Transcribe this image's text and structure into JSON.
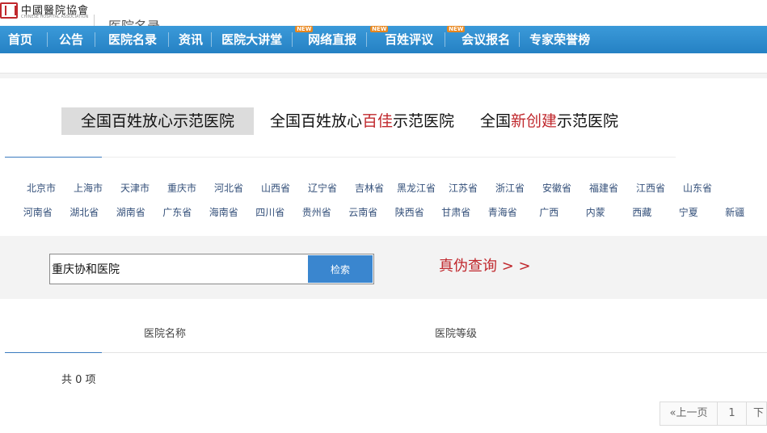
{
  "header": {
    "logo_text": "中國醫院協會",
    "logo_subtext": "CHINESE HOSPITAL ASSOCIATION",
    "peek_title": "医院名录"
  },
  "nav": {
    "items": [
      {
        "label": "首页",
        "badge": ""
      },
      {
        "label": "公告",
        "badge": ""
      },
      {
        "label": "医院名录",
        "badge": ""
      },
      {
        "label": "资讯",
        "badge": ""
      },
      {
        "label": "医院大讲堂",
        "badge": ""
      },
      {
        "label": "网络直报",
        "badge": "NEW"
      },
      {
        "label": "百姓评议",
        "badge": "NEW"
      },
      {
        "label": "会议报名",
        "badge": "NEW"
      },
      {
        "label": "专家荣誉榜",
        "badge": ""
      }
    ]
  },
  "tabs": {
    "t1": "全国百姓放心示范医院",
    "t2_pre": "全国百姓放心",
    "t2_hl": "百佳",
    "t2_post": "示范医院",
    "t3_pre": "全国",
    "t3_hl": "新创建",
    "t3_post": "示范医院"
  },
  "provinces": {
    "row1": [
      "北京市",
      "上海市",
      "天津市",
      "重庆市",
      "河北省",
      "山西省",
      "辽宁省",
      "吉林省",
      "黑龙江省",
      "江苏省",
      "浙江省",
      "安徽省",
      "福建省",
      "江西省",
      "山东省"
    ],
    "row2": [
      "河南省",
      "湖北省",
      "湖南省",
      "广东省",
      "海南省",
      "四川省",
      "贵州省",
      "云南省",
      "陕西省",
      "甘肃省",
      "青海省",
      "广西",
      "内蒙",
      "西藏",
      "宁夏",
      "新疆"
    ]
  },
  "search": {
    "value": "重庆协和医院",
    "button_label": "检索",
    "verify_link": "真伪查询 > >"
  },
  "results": {
    "col_name": "医院名称",
    "col_level": "医院等级",
    "count_text": "共 0 项"
  },
  "pager": {
    "prev": "«上一页",
    "page": "1",
    "next": "下"
  },
  "colors": {
    "nav_blue": "#2581c4",
    "accent_red": "#c0282d",
    "badge_orange": "#e8871e"
  }
}
